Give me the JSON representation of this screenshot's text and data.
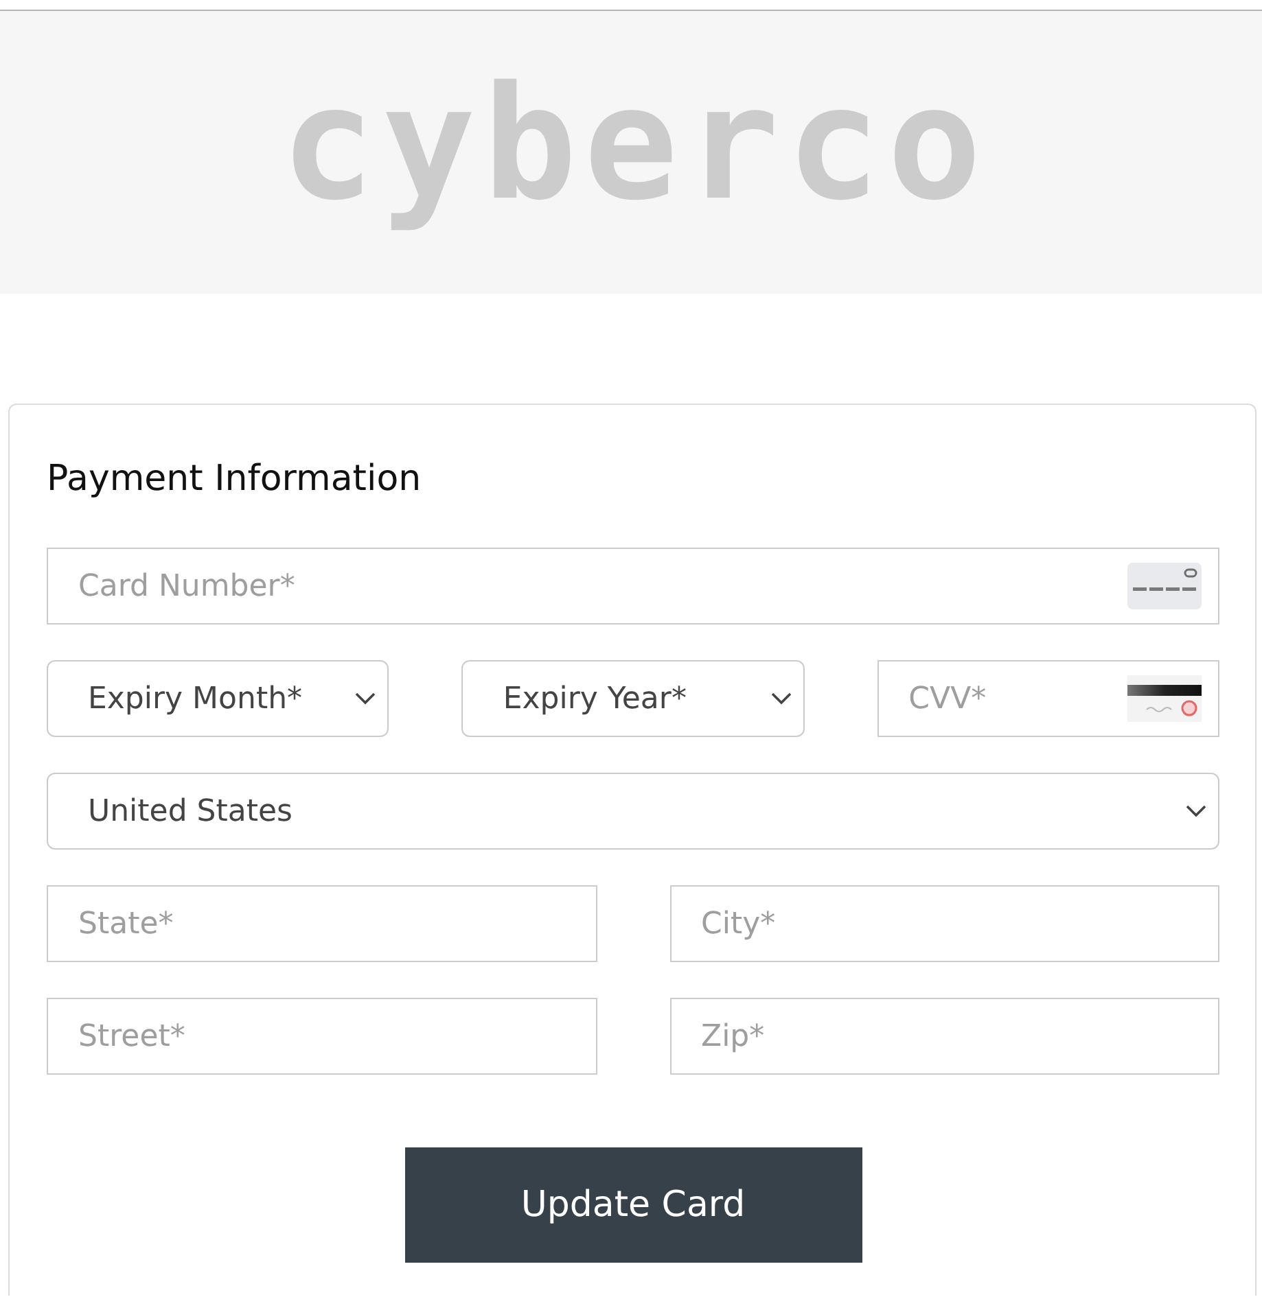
{
  "header": {
    "logo": "cyberco"
  },
  "payment_form": {
    "title": "Payment Information",
    "rows": [
      {
        "fields": [
          {
            "kind": "card_number",
            "placeholder": "Card Number*"
          }
        ]
      },
      {
        "fields": [
          {
            "kind": "select",
            "value": "Expiry Month*"
          },
          {
            "kind": "select",
            "value": "Expiry Year*"
          },
          {
            "kind": "cvv",
            "placeholder": "CVV*"
          }
        ]
      },
      {
        "fields": [
          {
            "kind": "select",
            "value": "United States"
          }
        ]
      },
      {
        "fields": [
          {
            "kind": "input",
            "placeholder": "State*"
          },
          {
            "kind": "input",
            "placeholder": "City*"
          }
        ]
      },
      {
        "fields": [
          {
            "kind": "input",
            "placeholder": "Street*"
          },
          {
            "kind": "input",
            "placeholder": "Zip*"
          }
        ]
      }
    ],
    "submit_button": "Update Card"
  }
}
